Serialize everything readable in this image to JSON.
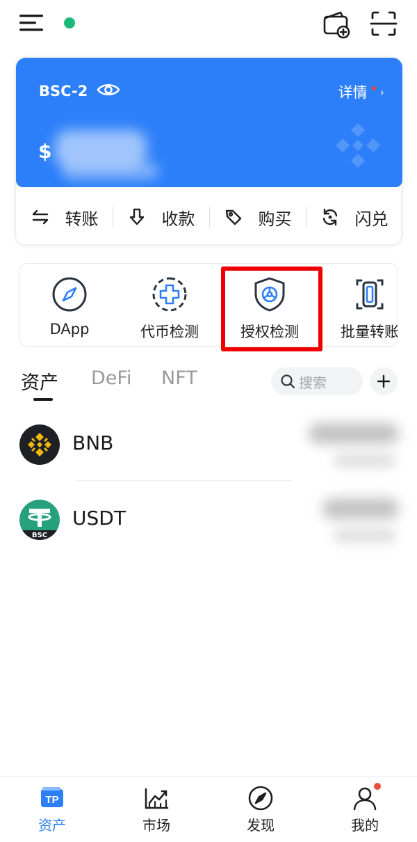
{
  "colors": {
    "accent": "#2d7ff9",
    "status_online": "#1ab97a",
    "notify_dot": "#f04a3c",
    "highlight_red": "#ee0000",
    "bnb_yellow": "#f0b90b",
    "usdt_green": "#26a17b"
  },
  "header": {
    "icons": [
      "menu-icon",
      "wallet-add-icon",
      "scan-icon"
    ]
  },
  "wallet": {
    "name": "BSC-2",
    "detail_label": "详情",
    "detail_chevron": "›",
    "currency_symbol": "$"
  },
  "actions": [
    {
      "label": "转账",
      "icon": "transfer-icon"
    },
    {
      "label": "收款",
      "icon": "receive-icon"
    },
    {
      "label": "购买",
      "icon": "buy-tag-icon"
    },
    {
      "label": "闪兑",
      "icon": "swap-icon"
    }
  ],
  "tools": [
    {
      "label": "DApp",
      "icon": "compass-icon"
    },
    {
      "label": "代币检测",
      "icon": "token-check-icon"
    },
    {
      "label": "授权检测",
      "icon": "shield-check-icon"
    },
    {
      "label": "批量转账",
      "icon": "batch-transfer-icon"
    }
  ],
  "tabs": [
    {
      "label": "资产",
      "active": true
    },
    {
      "label": "DeFi",
      "active": false
    },
    {
      "label": "NFT",
      "active": false
    }
  ],
  "search": {
    "placeholder": "搜索"
  },
  "add_label": "+",
  "tokens": [
    {
      "symbol": "BNB",
      "icon": "bnb-logo-icon"
    },
    {
      "symbol": "USDT",
      "icon": "usdt-logo-icon",
      "badge": "BSC"
    }
  ],
  "bottom_nav": [
    {
      "label": "资产",
      "icon": "tp-wallet-icon",
      "active": true
    },
    {
      "label": "市场",
      "icon": "market-chart-icon",
      "active": false
    },
    {
      "label": "发现",
      "icon": "discover-compass-icon",
      "active": false
    },
    {
      "label": "我的",
      "icon": "profile-icon",
      "active": false
    }
  ]
}
